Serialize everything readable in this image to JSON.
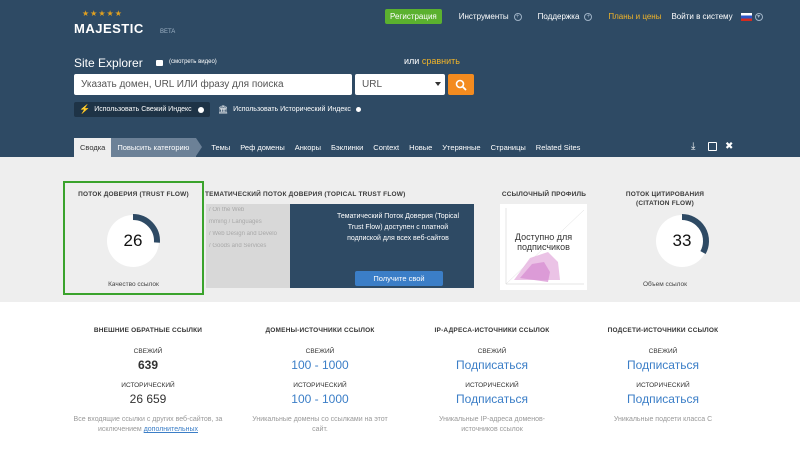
{
  "header": {
    "brand": "MAJESTIC",
    "beta": "BETA",
    "register_label": "Регистрация",
    "tools_label": "Инструменты",
    "support_label": "Поддержка",
    "plans_label": "Планы и цены",
    "login_label": "Войти в систему",
    "language_flag": "ru-flag-icon"
  },
  "explorer": {
    "title": "Site Explorer",
    "video_label": "(смотреть видео)",
    "or_label": "или",
    "compare_label": "сравнить",
    "search_placeholder": "Указать домен, URL ИЛИ фразу для поиска",
    "search_type": "URL",
    "fresh_index_label": "Использовать Свежий Индекс",
    "historic_index_label": "Использовать Исторический Индекс"
  },
  "tabs": [
    {
      "label": "Сводка",
      "active": true
    },
    {
      "label": "Повысить категорию"
    },
    {
      "label": "Темы"
    },
    {
      "label": "Реф домены"
    },
    {
      "label": "Анкоры"
    },
    {
      "label": "Бэклинки"
    },
    {
      "label": "Context"
    },
    {
      "label": "Новые"
    },
    {
      "label": "Утерянные"
    },
    {
      "label": "Страницы"
    },
    {
      "label": "Related Sites"
    }
  ],
  "trust_flow": {
    "title": "ПОТОК ДОВЕРИЯ (TRUST FLOW)",
    "value": "26",
    "caption": "Качество ссылок",
    "gauge_fraction": 0.26
  },
  "topical": {
    "title": "ТЕМАТИЧЕСКИЙ ПОТОК ДОВЕРИЯ (TOPICAL TRUST FLOW)",
    "list": [
      "/ On the Web",
      "mming / Languages",
      "/ Web Design and Develo",
      "/ Goods and Services"
    ],
    "message": "Тематический Поток Доверия (Topical Trust Flow) доступен с платной подпиской для всех веб-сайтов",
    "button_label": "Получите свой"
  },
  "link_profile": {
    "title": "ССЫЛОЧНЫЙ ПРОФИЛЬ",
    "overlay": "Доступно для подписчиков"
  },
  "citation_flow": {
    "title": "ПОТОК ЦИТИРОВАНИЯ (CITATION FLOW)",
    "value": "33",
    "caption": "Объем ссылок",
    "gauge_fraction": 0.33
  },
  "stats": [
    {
      "title": "ВНЕШНИЕ ОБРАТНЫЕ ССЫЛКИ",
      "fresh_label": "СВЕЖИЙ",
      "fresh_value": "639",
      "historic_label": "ИСТОРИЧЕСКИЙ",
      "historic_value": "26 659",
      "desc": "Все входящие ссылки с других веб-сайтов, за исключением",
      "desc_link": "дополнительных"
    },
    {
      "title": "ДОМЕНЫ-ИСТОЧНИКИ ССЫЛОК",
      "fresh_label": "СВЕЖИЙ",
      "fresh_value": "100 - 1000",
      "historic_label": "ИСТОРИЧЕСКИЙ",
      "historic_value": "100 - 1000",
      "desc": "Уникальные домены со ссылками на этот сайт."
    },
    {
      "title": "IP-АДРЕСА-ИСТОЧНИКИ ССЫЛОК",
      "fresh_label": "СВЕЖИЙ",
      "fresh_value": "Подписаться",
      "historic_label": "ИСТОРИЧЕСКИЙ",
      "historic_value": "Подписаться",
      "desc": "Уникальные IP-адреса доменов-источников ссылок"
    },
    {
      "title": "ПОДСЕТИ-ИСТОЧНИКИ ССЫЛОК",
      "fresh_label": "СВЕЖИЙ",
      "fresh_value": "Подписаться",
      "historic_label": "ИСТОРИЧЕСКИЙ",
      "historic_value": "Подписаться",
      "desc": "Уникальные подсети класса C"
    }
  ],
  "colors": {
    "header_bg": "#2e4a64",
    "accent_orange": "#f38b1f",
    "green": "#3aa32c",
    "link_blue": "#3b7ec7"
  }
}
